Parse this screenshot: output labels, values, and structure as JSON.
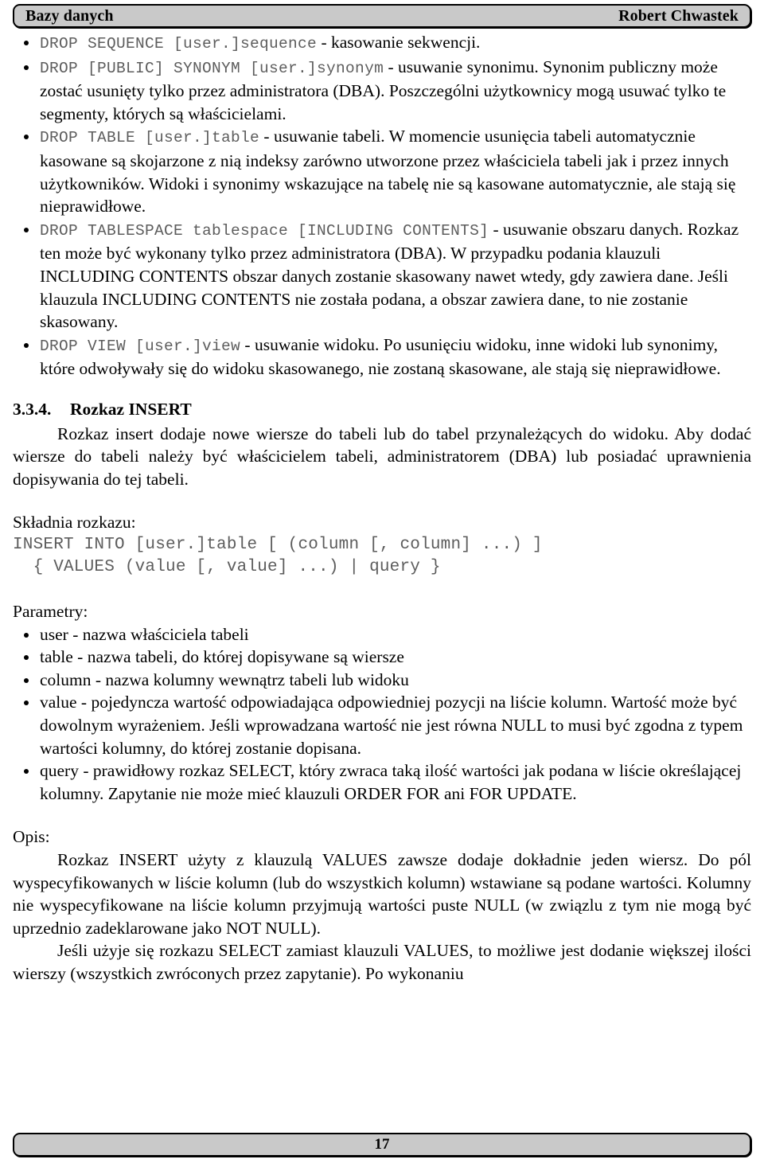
{
  "header": {
    "left_title": "Bazy danych",
    "right_author": "Robert Chwastek"
  },
  "footer": {
    "page_number": "17"
  },
  "drop_bullets": [
    {
      "code": "DROP SEQUENCE [user.]sequence",
      "text": " - kasowanie sekwencji."
    },
    {
      "code": "DROP [PUBLIC] SYNONYM [user.]synonym",
      "text": " - usuwanie synonimu. Synonim publiczny może zostać usunięty tylko przez administratora (DBA). Poszczególni użytkownicy mogą usuwać tylko te segmenty, których są właścicielami."
    },
    {
      "code": "DROP TABLE [user.]table",
      "text": " - usuwanie tabeli. W momencie usunięcia tabeli automatycznie kasowane są skojarzone z nią indeksy zarówno utworzone przez właściciela tabeli jak i przez innych użytkowników. Widoki i synonimy wskazujące na tabelę nie są kasowane automatycznie, ale stają się nieprawidłowe."
    },
    {
      "code": "DROP TABLESPACE tablespace [INCLUDING CONTENTS]",
      "text": " - usuwanie obszaru danych. Rozkaz ten może być wykonany tylko przez administratora (DBA). W przypadku podania klauzuli INCLUDING CONTENTS obszar danych zostanie skasowany nawet wtedy, gdy zawiera dane. Jeśli klauzula INCLUDING CONTENTS nie została podana, a obszar zawiera dane, to nie zostanie skasowany."
    },
    {
      "code": "DROP VIEW [user.]view",
      "text": " - usuwanie widoku. Po usunięciu widoku, inne widoki lub synonimy, które odwoływały się do widoku skasowanego, nie zostaną skasowane, ale stają się nieprawidłowe."
    }
  ],
  "section": {
    "number": "3.3.4.",
    "title": "Rozkaz INSERT",
    "intro": "Rozkaz insert dodaje nowe wiersze do tabeli lub do tabel przynależących do widoku. Aby dodać wiersze do tabeli należy być właścicielem tabeli, administratorem (DBA) lub posiadać uprawnienia dopisywania do tej tabeli."
  },
  "syntax": {
    "label": "Składnia rozkazu:",
    "code": "INSERT INTO [user.]table [ (column [, column] ...) ]\n  { VALUES (value [, value] ...) | query }"
  },
  "parameters": {
    "label": "Parametry:",
    "items": [
      "user - nazwa właściciela tabeli",
      "table - nazwa tabeli, do której dopisywane są wiersze",
      "column - nazwa kolumny wewnątrz tabeli lub widoku",
      "value - pojedyncza wartość odpowiadająca odpowiedniej pozycji na liście kolumn. Wartość może być dowolnym wyrażeniem. Jeśli wprowadzana wartość nie jest równa NULL to musi być zgodna z typem wartości kolumny, do której zostanie dopisana.",
      "query - prawidłowy rozkaz SELECT, który zwraca taką ilość wartości jak podana w liście określającej kolumny. Zapytanie nie może mieć klauzuli ORDER FOR ani FOR UPDATE."
    ]
  },
  "description": {
    "label": "Opis:",
    "paragraph_1": "Rozkaz INSERT użyty z klauzulą VALUES zawsze dodaje dokładnie jeden wiersz. Do pól wyspecyfikowanych w liście kolumn (lub do wszystkich kolumn) wstawiane są podane wartości. Kolumny nie wyspecyfikowane na liście kolumn przyjmują wartości puste NULL (w związlu z tym nie mogą być uprzednio zadeklarowane jako NOT NULL).",
    "paragraph_2": "Jeśli użyje się rozkazu SELECT zamiast klauzuli VALUES, to możliwe jest dodanie większej ilości wierszy (wszystkich zwróconych przez zapytanie). Po wykonaniu"
  }
}
